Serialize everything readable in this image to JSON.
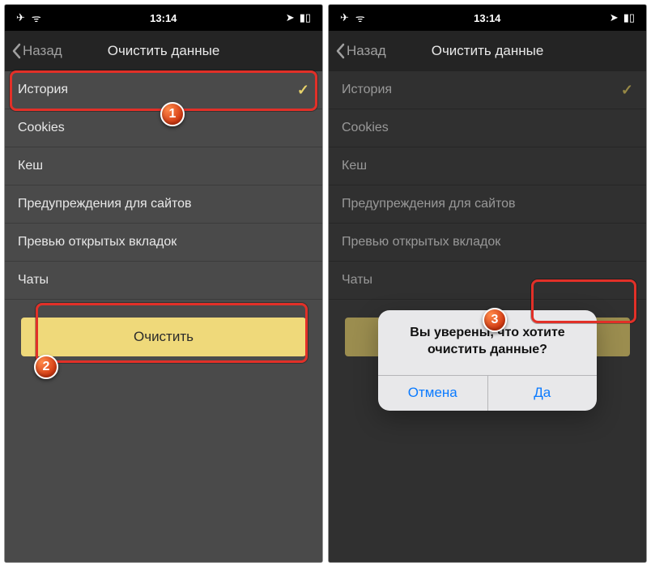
{
  "status": {
    "time": "13:14",
    "airplane_glyph": "✈",
    "wifi_glyph": "ᯤ",
    "location_glyph": "➤",
    "battery_glyph": "▮▯"
  },
  "nav": {
    "back": "Назад",
    "title": "Очистить данные"
  },
  "rows": [
    {
      "label": "История",
      "checked": true
    },
    {
      "label": "Cookies",
      "checked": false
    },
    {
      "label": "Кеш",
      "checked": false
    },
    {
      "label": "Предупреждения для сайтов",
      "checked": false
    },
    {
      "label": "Превью открытых вкладок",
      "checked": false
    },
    {
      "label": "Чаты",
      "checked": false
    }
  ],
  "clear_button": "Очистить",
  "alert": {
    "line1": "Вы уверены, что хотите",
    "line2": "очистить данные?",
    "cancel": "Отмена",
    "confirm": "Да"
  },
  "badges": {
    "b1": "1",
    "b2": "2",
    "b3": "3"
  }
}
